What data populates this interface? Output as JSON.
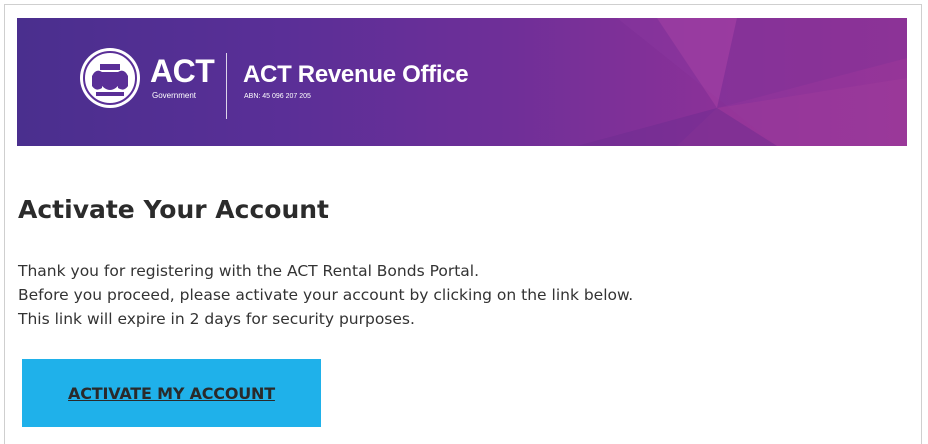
{
  "banner": {
    "act_wordmark": "ACT",
    "government_word": "Government",
    "office_title": "ACT Revenue Office",
    "abn": "ABN: 45 096 207 205",
    "crest_icon": "act-government-crest"
  },
  "email": {
    "heading": "Activate Your Account",
    "body_lines": [
      "Thank you for registering with the ACT Rental Bonds Portal.",
      "Before you proceed, please activate your account by clicking on the link below.",
      "This link will expire in 2 days for security purposes."
    ],
    "cta_label": "ACTIVATE MY ACCOUNT"
  },
  "colors": {
    "banner_start": "#4a2f8e",
    "banner_end": "#9b3394",
    "cta_background": "#1fb1ea",
    "heading_text": "#2b2b2b"
  }
}
